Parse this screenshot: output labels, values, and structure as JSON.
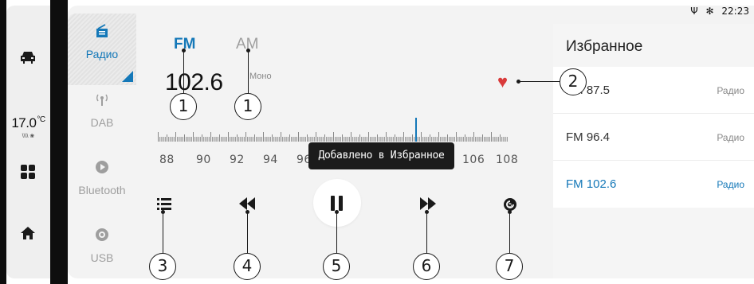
{
  "status_bar": {
    "time": "22:23",
    "usb_icon": "Ψ",
    "bluetooth_icon": "✻"
  },
  "left_rail": {
    "temperature": "17.0",
    "temperature_unit": "°C",
    "fan_indicator": "\\\\\\\\ ❀"
  },
  "sources": [
    {
      "label": "Радио",
      "icon": "radio-icon",
      "active": true
    },
    {
      "label": "DAB",
      "icon": "dab-antenna-icon",
      "active": false
    },
    {
      "label": "Bluetooth",
      "icon": "bluetooth-play-icon",
      "active": false
    },
    {
      "label": "USB",
      "icon": "usb-disc-icon",
      "active": false
    }
  ],
  "player": {
    "band_fm": "FM",
    "band_am": "AM",
    "frequency": "102.6",
    "mode": "Моно",
    "scale": [
      "88",
      "90",
      "92",
      "94",
      "96",
      "106",
      "108"
    ],
    "toast": "Добавлено в Избранное"
  },
  "favorites": {
    "title": "Избранное",
    "items": [
      {
        "name": "FM 87.5",
        "type": "Радио",
        "active": false
      },
      {
        "name": "FM 96.4",
        "type": "Радио",
        "active": false
      },
      {
        "name": "FM 102.6",
        "type": "Радио",
        "active": true
      }
    ]
  },
  "callouts": [
    "1",
    "1",
    "2",
    "3",
    "4",
    "5",
    "6",
    "7"
  ],
  "colors": {
    "accent": "#1478b8",
    "heart": "#d93a3a",
    "toast_bg": "#1b1b1b"
  }
}
